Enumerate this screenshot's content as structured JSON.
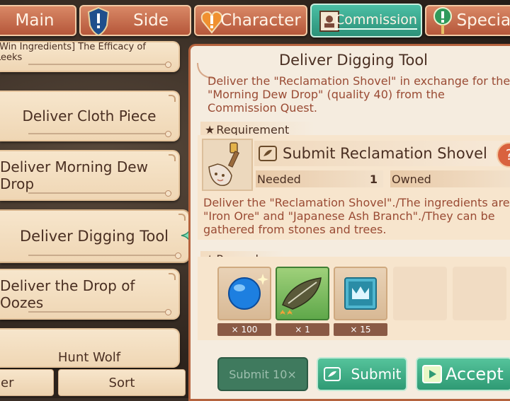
{
  "tabs": {
    "main": "Main",
    "side": "Side",
    "character": "Character",
    "commission": "Commission",
    "special": "Special"
  },
  "quest_list": {
    "items": [
      "[Win Ingredients] The Efficacy of Leeks",
      "Deliver Cloth Piece",
      "Deliver Morning Dew Drop",
      "Deliver Digging Tool",
      "Deliver the Drop of Oozes",
      "Hunt Wolf"
    ],
    "selected": "Deliver Digging Tool"
  },
  "bottom_buttons": {
    "filter": "er",
    "sort": "Sort"
  },
  "detail": {
    "title": "Deliver Digging Tool",
    "description": "Deliver the \"Reclamation Shovel\" in exchange for the \"Morning Dew Drop\" (quality 40) from the Commission Quest.",
    "requirement_label": "Requirement",
    "requirement_title": "Submit Reclamation Shovel",
    "needed_label": "Needed",
    "needed_value": "1",
    "owned_label": "Owned",
    "requirement_text": "Deliver the \"Reclamation Shovel\"./The ingredients are \"Iron Ore\" and \"Japanese Ash Branch\"./They can be gathered from stones and trees.",
    "reward_label": "Reward",
    "rewards": [
      {
        "icon": "blue-orb-icon",
        "count": "× 100"
      },
      {
        "icon": "leaf-icon",
        "count": "× 1"
      },
      {
        "icon": "crown-icon",
        "count": "× 15"
      }
    ]
  },
  "actions": {
    "submit10": "Submit 10×",
    "submit": "Submit",
    "accept": "Accept"
  },
  "colors": {
    "tab": "#c86a4a",
    "tab_active": "#3aa88e",
    "panel": "#f5ecdf",
    "accent_text": "#9a4b34"
  }
}
